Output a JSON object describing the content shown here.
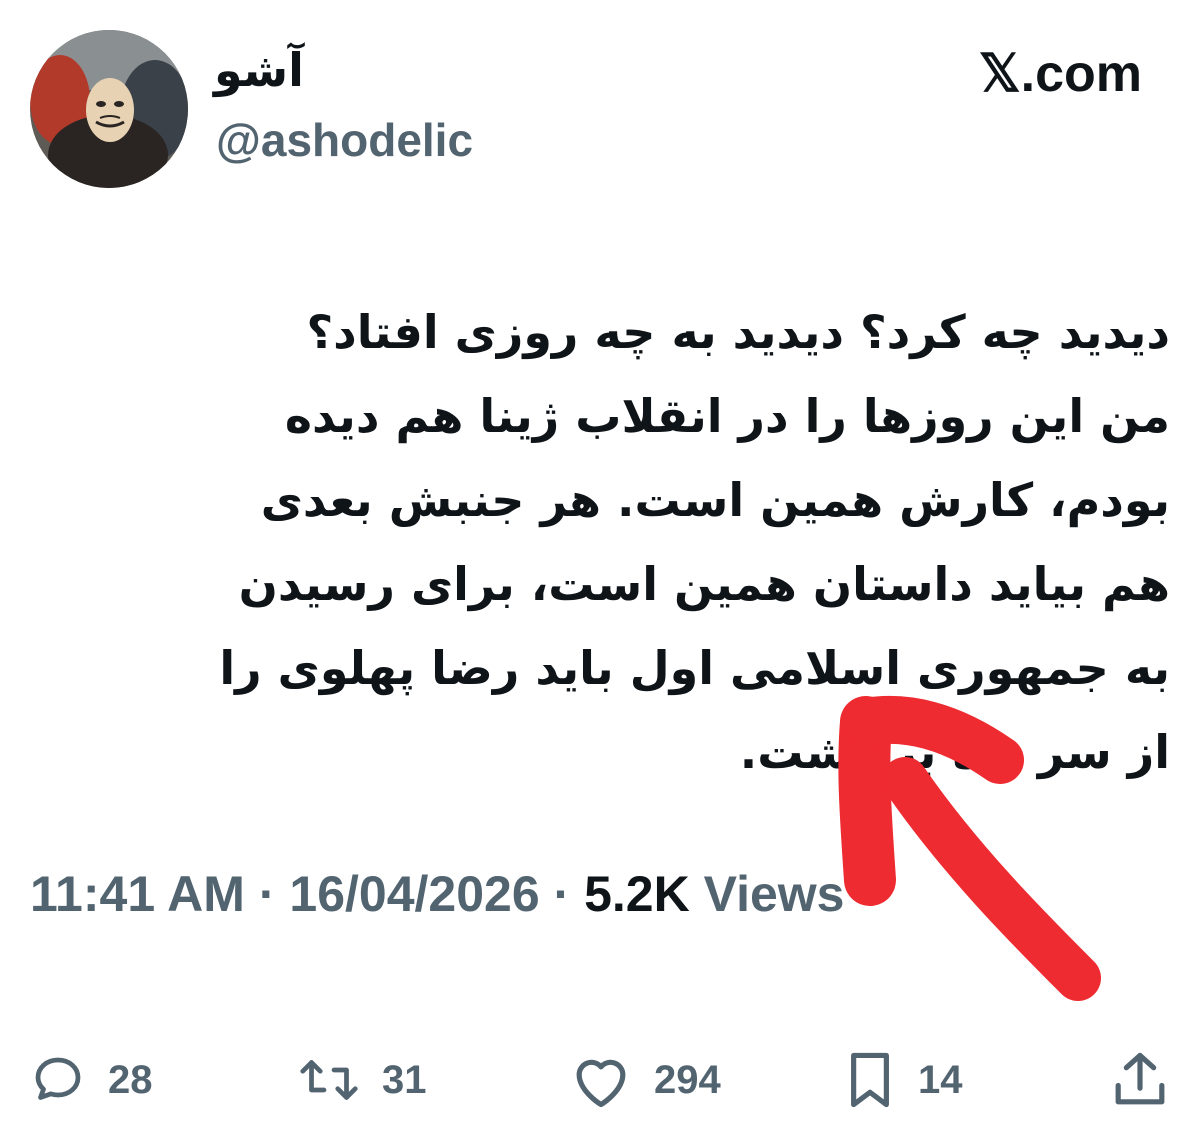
{
  "header": {
    "display_name": "آشو",
    "handle": "@ashodelic",
    "brand": "𝕏.com"
  },
  "tweet": {
    "text": "دیدید چه کرد؟ دیدید به چه روزی افتاد؟\nمن این روزها را در انقلاب ژینا هم دیده\nبودم، کارش همین است. هر جنبش بعدی\nهم بیاید داستان همین است، برای رسیدن\nبه جمهوری اسلامی اول باید رضا پهلوی را\nاز سر راه برداشت."
  },
  "meta": {
    "time": "11:41 AM",
    "separator": "·",
    "date": "16/04/2026",
    "views_count": "5.2K",
    "views_label": "Views"
  },
  "actions": {
    "reply_count": "28",
    "retweet_count": "31",
    "like_count": "294",
    "bookmark_count": "14"
  },
  "icons": {
    "reply": "reply-icon",
    "retweet": "retweet-icon",
    "like": "heart-icon",
    "bookmark": "bookmark-icon",
    "share": "share-icon"
  },
  "colors": {
    "text": "#0f1419",
    "secondary": "#536471",
    "annotation_arrow": "#ee2b30"
  }
}
